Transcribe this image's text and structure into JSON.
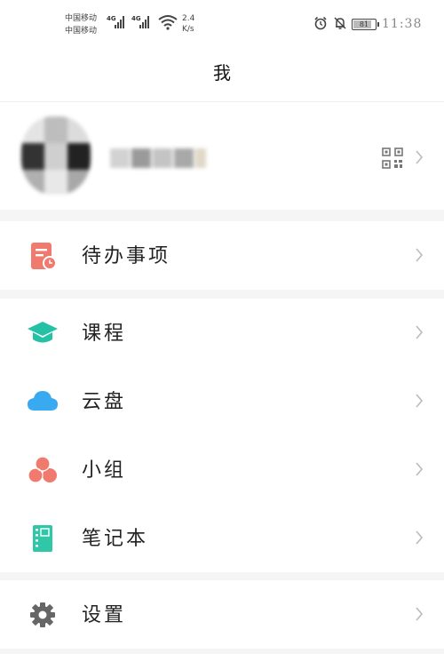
{
  "status_bar": {
    "carrier_1": "中国移动",
    "carrier_2": "中国移动",
    "network_1": "4G",
    "network_2": "4G",
    "speed_value": "2.4",
    "speed_unit": "K/s",
    "battery": "81",
    "time": "11:38",
    "icons": [
      "alarm-icon",
      "mute-icon",
      "wifi-icon",
      "battery-icon"
    ]
  },
  "header": {
    "title": "我"
  },
  "profile": {
    "avatar": "avatar-pixelated",
    "name_blurred": true,
    "icons": [
      "qr-code-icon",
      "chevron-right-icon"
    ]
  },
  "menu": {
    "section1": [
      {
        "label": "待办事项",
        "icon": "todo-clipboard-icon",
        "color": "#f07a6e"
      }
    ],
    "section2": [
      {
        "label": "课程",
        "icon": "graduation-cap-icon",
        "color": "#23c1a5"
      },
      {
        "label": "云盘",
        "icon": "cloud-icon",
        "color": "#3aaaf0"
      },
      {
        "label": "小组",
        "icon": "group-circles-icon",
        "color": "#f07a6e"
      },
      {
        "label": "笔记本",
        "icon": "notebook-icon",
        "color": "#2fc7a8"
      }
    ],
    "section3": [
      {
        "label": "设置",
        "icon": "gear-icon",
        "color": "#666666"
      }
    ]
  },
  "colors": {
    "background": "#f5f5f5",
    "chevron": "#bbbbbb"
  }
}
